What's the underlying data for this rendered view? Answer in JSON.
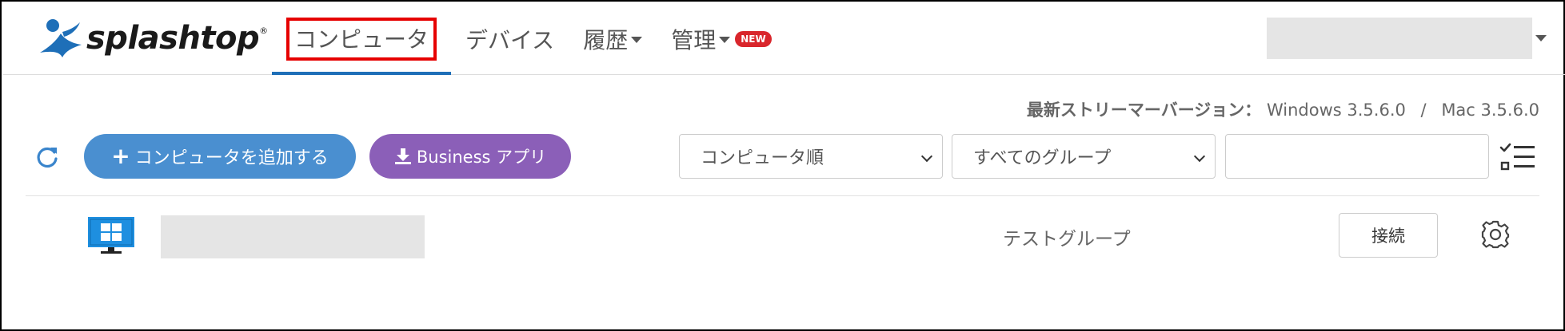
{
  "brand": {
    "name": "splashtop",
    "reg": "®"
  },
  "nav": {
    "computers": "コンピュータ",
    "devices": "デバイス",
    "history": "履歴",
    "management": "管理",
    "new_badge": "NEW"
  },
  "version": {
    "label": "最新ストリーマーバージョン：",
    "windows": "Windows 3.5.6.0",
    "separator": "/",
    "mac": "Mac 3.5.6.0"
  },
  "toolbar": {
    "add_computer": "コンピュータを追加する",
    "business_app": "Business アプリ",
    "sort_selected": "コンピュータ順",
    "group_selected": "すべてのグループ",
    "search_value": ""
  },
  "computers": [
    {
      "group": "テストグループ",
      "connect_label": "接続"
    }
  ],
  "colors": {
    "accent_blue": "#4a8fd0",
    "nav_underline": "#1e6fb8",
    "business_purple": "#8b5fb8",
    "highlight_red": "#e60000",
    "badge_red": "#d9262c",
    "windows_blue": "#1e8fe0"
  },
  "icons": [
    "splashtop-logo-icon",
    "refresh-icon",
    "plus-icon",
    "download-icon",
    "checklist-icon",
    "windows-monitor-icon",
    "gear-icon"
  ]
}
